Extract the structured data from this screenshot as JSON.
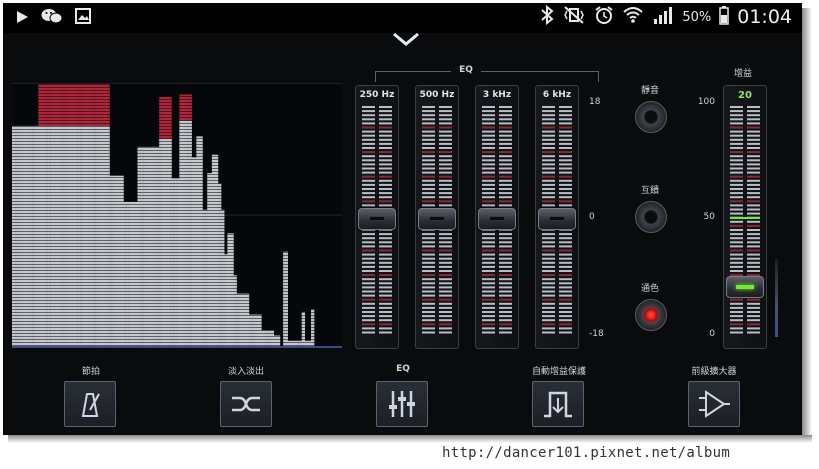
{
  "status_bar": {
    "left_icons": [
      "play-icon",
      "wechat-icon",
      "gallery-icon"
    ],
    "right_icons": [
      "bluetooth-icon",
      "vibrate-icon",
      "alarm-icon",
      "wifi-icon",
      "signal-icon",
      "battery-icon"
    ],
    "battery": "50%",
    "time": "01:04"
  },
  "spectrum": {
    "bars": [
      [
        0.84,
        0.0
      ],
      [
        0.84,
        0.0
      ],
      [
        0.84,
        0.0
      ],
      [
        0.84,
        0.0
      ],
      [
        0.84,
        0.0
      ],
      [
        0.84,
        0.0
      ],
      [
        0.84,
        0.0
      ],
      [
        0.84,
        0.0
      ],
      [
        0.84,
        0.0
      ],
      [
        0.84,
        0.0
      ],
      [
        0.84,
        0.0
      ],
      [
        0.84,
        0.0
      ],
      [
        0.84,
        0.0
      ],
      [
        0.84,
        0.0
      ],
      [
        0.84,
        0.0
      ],
      [
        0.84,
        0.0
      ],
      [
        0.84,
        0.0
      ],
      [
        1.0,
        0.16
      ],
      [
        1.0,
        0.16
      ],
      [
        1.0,
        0.16
      ],
      [
        1.0,
        0.16
      ],
      [
        1.0,
        0.16
      ],
      [
        1.0,
        0.16
      ],
      [
        1.0,
        0.16
      ],
      [
        1.0,
        0.16
      ],
      [
        1.0,
        0.16
      ],
      [
        1.0,
        0.16
      ],
      [
        1.0,
        0.16
      ],
      [
        1.0,
        0.16
      ],
      [
        1.0,
        0.16
      ],
      [
        1.0,
        0.16
      ],
      [
        1.0,
        0.16
      ],
      [
        1.0,
        0.16
      ],
      [
        1.0,
        0.16
      ],
      [
        1.0,
        0.16
      ],
      [
        1.0,
        0.16
      ],
      [
        1.0,
        0.16
      ],
      [
        1.0,
        0.16
      ],
      [
        1.0,
        0.16
      ],
      [
        1.0,
        0.16
      ],
      [
        1.0,
        0.16
      ],
      [
        1.0,
        0.16
      ],
      [
        1.0,
        0.16
      ],
      [
        1.0,
        0.16
      ],
      [
        1.0,
        0.16
      ],
      [
        1.0,
        0.16
      ],
      [
        1.0,
        0.16
      ],
      [
        1.0,
        0.16
      ],
      [
        1.0,
        0.16
      ],
      [
        1.0,
        0.16
      ],
      [
        1.0,
        0.16
      ],
      [
        1.0,
        0.16
      ],
      [
        1.0,
        0.16
      ],
      [
        1.0,
        0.16
      ],
      [
        1.0,
        0.16
      ],
      [
        1.0,
        0.16
      ],
      [
        1.0,
        0.16
      ],
      [
        1.0,
        0.16
      ],
      [
        1.0,
        0.16
      ],
      [
        1.0,
        0.16
      ],
      [
        1.0,
        0.16
      ],
      [
        1.0,
        0.16
      ],
      [
        1.0,
        0.16
      ],
      [
        0.65,
        0.0
      ],
      [
        0.65,
        0.0
      ],
      [
        0.65,
        0.0
      ],
      [
        0.65,
        0.0
      ],
      [
        0.65,
        0.0
      ],
      [
        0.65,
        0.0
      ],
      [
        0.65,
        0.0
      ],
      [
        0.65,
        0.0
      ],
      [
        0.65,
        0.0
      ],
      [
        0.55,
        0.0
      ],
      [
        0.55,
        0.0
      ],
      [
        0.55,
        0.0
      ],
      [
        0.55,
        0.0
      ],
      [
        0.55,
        0.0
      ],
      [
        0.55,
        0.0
      ],
      [
        0.55,
        0.0
      ],
      [
        0.55,
        0.0
      ],
      [
        0.55,
        0.0
      ],
      [
        0.76,
        0.0
      ],
      [
        0.76,
        0.0
      ],
      [
        0.76,
        0.0
      ],
      [
        0.76,
        0.0
      ],
      [
        0.76,
        0.0
      ],
      [
        0.76,
        0.0
      ],
      [
        0.76,
        0.0
      ],
      [
        0.76,
        0.0
      ],
      [
        0.76,
        0.0
      ],
      [
        0.76,
        0.0
      ],
      [
        0.76,
        0.0
      ],
      [
        0.76,
        0.0
      ],
      [
        0.76,
        0.0
      ],
      [
        0.76,
        0.0
      ],
      [
        0.95,
        0.16
      ],
      [
        0.95,
        0.16
      ],
      [
        0.95,
        0.16
      ],
      [
        0.95,
        0.16
      ],
      [
        0.95,
        0.16
      ],
      [
        0.95,
        0.16
      ],
      [
        0.95,
        0.16
      ],
      [
        0.95,
        0.16
      ],
      [
        0.64,
        0.0
      ],
      [
        0.64,
        0.0
      ],
      [
        0.64,
        0.0
      ],
      [
        0.64,
        0.0
      ],
      [
        0.64,
        0.0
      ],
      [
        0.96,
        0.1
      ],
      [
        0.96,
        0.1
      ],
      [
        0.96,
        0.1
      ],
      [
        0.96,
        0.1
      ],
      [
        0.96,
        0.1
      ],
      [
        0.96,
        0.1
      ],
      [
        0.96,
        0.1
      ],
      [
        0.96,
        0.1
      ],
      [
        0.72,
        0.0
      ],
      [
        0.72,
        0.0
      ],
      [
        0.72,
        0.0
      ],
      [
        0.8,
        0.0
      ],
      [
        0.8,
        0.0
      ],
      [
        0.8,
        0.0
      ],
      [
        0.8,
        0.0
      ],
      [
        0.52,
        0.0
      ],
      [
        0.52,
        0.0
      ],
      [
        0.52,
        0.0
      ],
      [
        0.66,
        0.0
      ],
      [
        0.66,
        0.0
      ],
      [
        0.66,
        0.0
      ],
      [
        0.73,
        0.0
      ],
      [
        0.73,
        0.0
      ],
      [
        0.73,
        0.0
      ],
      [
        0.73,
        0.0
      ],
      [
        0.62,
        0.0
      ],
      [
        0.62,
        0.0
      ],
      [
        0.52,
        0.0
      ],
      [
        0.52,
        0.0
      ],
      [
        0.35,
        0.0
      ],
      [
        0.35,
        0.0
      ],
      [
        0.43,
        0.0
      ],
      [
        0.43,
        0.0
      ],
      [
        0.43,
        0.0
      ],
      [
        0.43,
        0.0
      ],
      [
        0.27,
        0.0
      ],
      [
        0.27,
        0.0
      ],
      [
        0.2,
        0.0
      ],
      [
        0.2,
        0.0
      ],
      [
        0.2,
        0.0
      ],
      [
        0.2,
        0.0
      ],
      [
        0.2,
        0.0
      ],
      [
        0.2,
        0.0
      ],
      [
        0.2,
        0.0
      ],
      [
        0.2,
        0.0
      ],
      [
        0.12,
        0.0
      ],
      [
        0.12,
        0.0
      ],
      [
        0.12,
        0.0
      ],
      [
        0.12,
        0.0
      ],
      [
        0.12,
        0.0
      ],
      [
        0.12,
        0.0
      ],
      [
        0.12,
        0.0
      ],
      [
        0.12,
        0.0
      ],
      [
        0.06,
        0.0
      ],
      [
        0.06,
        0.0
      ],
      [
        0.06,
        0.0
      ],
      [
        0.06,
        0.0
      ],
      [
        0.06,
        0.0
      ],
      [
        0.06,
        0.0
      ],
      [
        0.06,
        0.0
      ],
      [
        0.06,
        0.0
      ],
      [
        0.04,
        0.0
      ],
      [
        0.04,
        0.0
      ],
      [
        0.04,
        0.0
      ],
      [
        0.04,
        0.0
      ],
      [
        0.0,
        0.0
      ],
      [
        0.0,
        0.0
      ],
      [
        0.36,
        0.0
      ],
      [
        0.36,
        0.0
      ],
      [
        0.36,
        0.0
      ],
      [
        0.02,
        0.0
      ],
      [
        0.02,
        0.0
      ],
      [
        0.02,
        0.0
      ],
      [
        0.02,
        0.0
      ],
      [
        0.02,
        0.0
      ],
      [
        0.02,
        0.0
      ],
      [
        0.02,
        0.0
      ],
      [
        0.02,
        0.0
      ],
      [
        0.02,
        0.0
      ],
      [
        0.13,
        0.0
      ],
      [
        0.13,
        0.0
      ],
      [
        0.02,
        0.0
      ],
      [
        0.02,
        0.0
      ],
      [
        0.02,
        0.0
      ],
      [
        0.02,
        0.0
      ],
      [
        0.14,
        0.0
      ],
      [
        0.14,
        0.0
      ],
      [
        0.0,
        0.0
      ],
      [
        0.0,
        0.0
      ],
      [
        0.0,
        0.0
      ],
      [
        0.0,
        0.0
      ],
      [
        0.0,
        0.0
      ],
      [
        0.0,
        0.0
      ],
      [
        0.0,
        0.0
      ],
      [
        0.0,
        0.0
      ],
      [
        0.0,
        0.0
      ],
      [
        0.0,
        0.0
      ],
      [
        0.0,
        0.0
      ],
      [
        0.0,
        0.0
      ],
      [
        0.0,
        0.0
      ],
      [
        0.0,
        0.0
      ],
      [
        0.0,
        0.0
      ],
      [
        0.0,
        0.0
      ],
      [
        0.0,
        0.0
      ],
      [
        0.0,
        0.0
      ]
    ]
  },
  "eq": {
    "title": "EQ",
    "bands": [
      {
        "label": "250 Hz",
        "value_db": 0
      },
      {
        "label": "500 Hz",
        "value_db": 0
      },
      {
        "label": "3 kHz",
        "value_db": 0
      },
      {
        "label": "6 kHz",
        "value_db": 0
      }
    ],
    "scale_top": "18",
    "scale_mid": "0",
    "scale_bottom": "-18"
  },
  "toggles": {
    "mute": {
      "label": "靜音",
      "on": false
    },
    "monitor": {
      "label": "互饋",
      "on": false
    },
    "bypass": {
      "label": "通色",
      "on": true
    }
  },
  "gain": {
    "title": "增益",
    "value": "20",
    "scale_top": "100",
    "scale_mid": "50",
    "scale_bottom": "0"
  },
  "toolbar": {
    "metronome": "節拍",
    "crossfade": "淡入淡出",
    "eq": "EQ",
    "auto_gain": "自動增益保護",
    "preamp": "前級擴大器"
  },
  "watermark": "http://dancer101.pixnet.net/album"
}
